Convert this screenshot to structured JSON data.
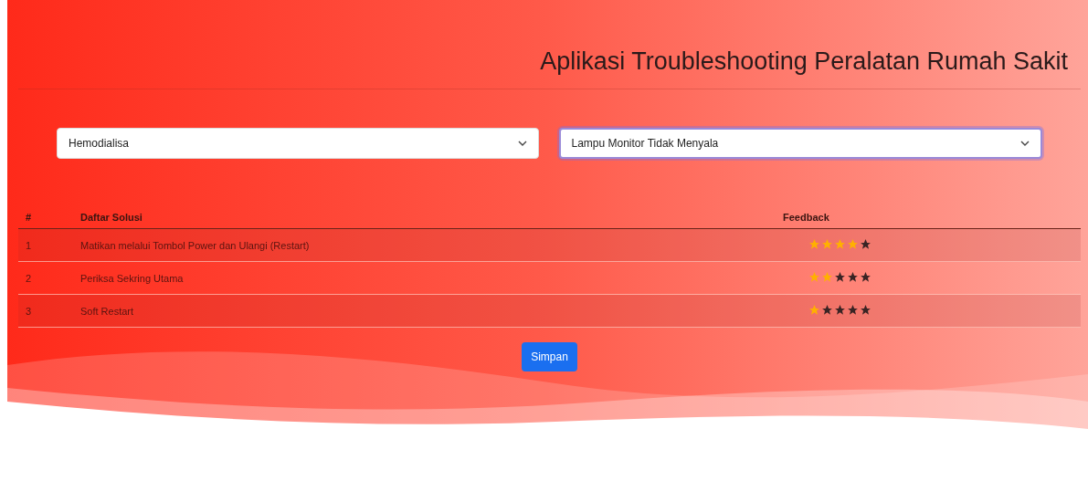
{
  "title": "Aplikasi Troubleshooting Peralatan Rumah Sakit",
  "selects": [
    {
      "value": "Hemodialisa",
      "focused": false
    },
    {
      "value": "Lampu Monitor Tidak Menyala",
      "focused": true
    }
  ],
  "table": {
    "columns": [
      "#",
      "Daftar Solusi",
      "Feedback"
    ],
    "rows": [
      {
        "no": "1",
        "solution": "Matikan melalui Tombol Power dan Ulangi (Restart)",
        "stars": 4
      },
      {
        "no": "2",
        "solution": "Periksa Sekring Utama",
        "stars": 2
      },
      {
        "no": "3",
        "solution": "Soft Restart",
        "stars": 1
      }
    ]
  },
  "button": "Simpan"
}
